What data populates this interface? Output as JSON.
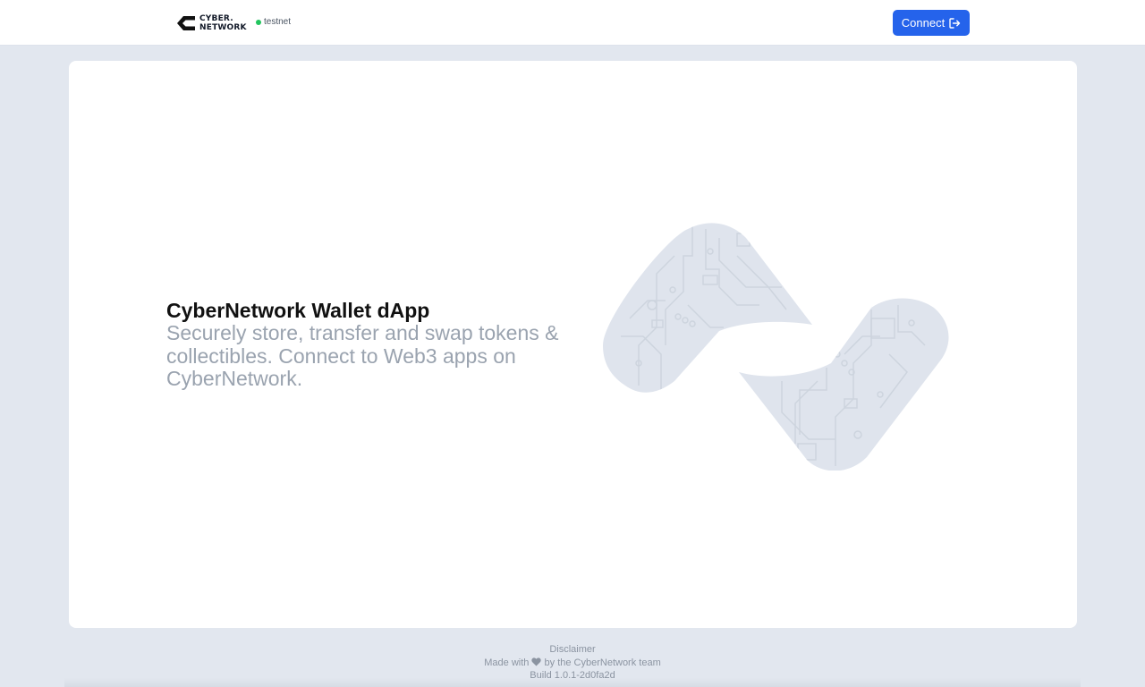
{
  "header": {
    "logo": {
      "line1": "CYBER.",
      "line2": "NETWORK",
      "icon": "cybernetwork-logo-icon"
    },
    "network_label": "testnet",
    "network_status_color": "#22c55e",
    "connect_label": "Connect",
    "connect_icon": "sign-in-arrow-icon"
  },
  "hero": {
    "title": "CyberNetwork Wallet dApp",
    "subtitle": "Securely store, transfer and swap tokens & collectibles. Connect to Web3 apps on CyberNetwork.",
    "illustration": "circuit-logo-illustration"
  },
  "footer": {
    "disclaimer": "Disclaimer",
    "made_with_prefix": "Made with",
    "made_with_suffix": "by the CyberNetwork team",
    "heart_icon": "heart-icon",
    "build": "Build 1.0.1-2d0fa2d"
  },
  "colors": {
    "accent": "#2563eb",
    "page_background": "#e2e7ef",
    "muted_text": "#9aa3af"
  }
}
